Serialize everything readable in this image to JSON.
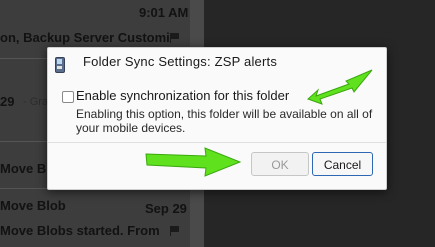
{
  "background": {
    "time_label": "9:01 AM",
    "row1_text": "on, Backup Server Customi",
    "row2_date": "29",
    "row2_text": "- Gra",
    "row3_text": "Move Blob",
    "row4_text": "Move Blob",
    "row5_date": "Sep 29",
    "row5_text": "Move Blobs started. From"
  },
  "dialog": {
    "title": "Folder Sync Settings: ZSP alerts",
    "checkbox_label": "Enable synchronization for this folder",
    "checkbox_checked": false,
    "description": "Enabling this option, this folder will be available on all of your mobile devices.",
    "ok_label": "OK",
    "cancel_label": "Cancel"
  },
  "colors": {
    "annotation_arrow": "#5fe11e",
    "cancel_focus_border": "#2e68b4"
  },
  "icons": [
    "mobile-device-icon",
    "flag-icon",
    "annotation-arrow-icon"
  ]
}
